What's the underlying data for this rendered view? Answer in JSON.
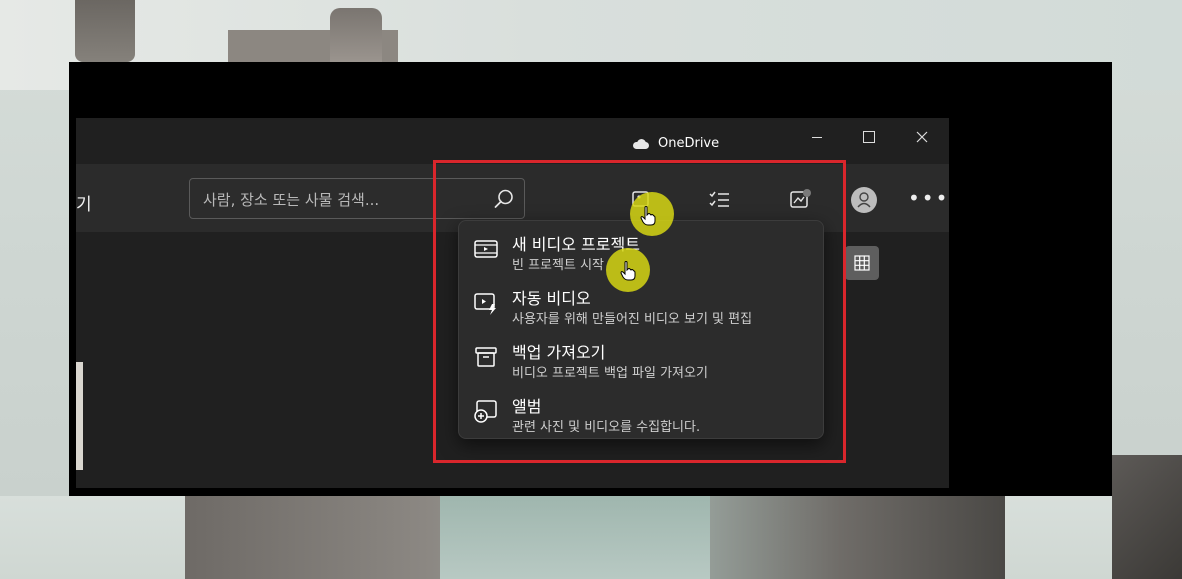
{
  "window": {
    "onedrive_label": "OneDrive",
    "left_nav_fragment": "기"
  },
  "search": {
    "placeholder": "사람, 장소 또는 사물 검색..."
  },
  "toolbar": {
    "icons": [
      "new-item-icon",
      "select-icon",
      "import-icon",
      "avatar",
      "more-icon"
    ]
  },
  "menu": {
    "items": [
      {
        "title": "새 비디오 프로젝트",
        "subtitle": "빈 프로젝트 시작",
        "icon": "film-icon"
      },
      {
        "title": "자동 비디오",
        "subtitle": "사용자를 위해 만들어진 비디오 보기 및 편집",
        "icon": "auto-video-icon"
      },
      {
        "title": "백업 가져오기",
        "subtitle": "비디오 프로젝트 백업 파일 가져오기",
        "icon": "archive-icon"
      },
      {
        "title": "앨범",
        "subtitle": "관련 사진 및 비디오를 수집합니다.",
        "icon": "album-add-icon"
      }
    ]
  },
  "colors": {
    "annotation_red": "#d9262c",
    "highlight_yellow": "#d6d614",
    "app_background": "#202020",
    "menu_background": "#2c2c2c"
  }
}
